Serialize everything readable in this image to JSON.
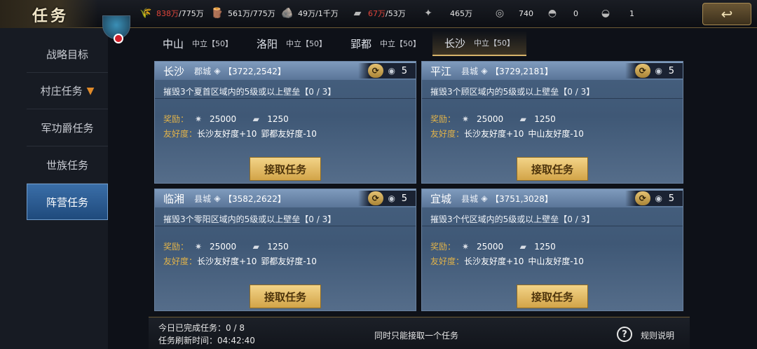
{
  "header": {
    "title": "任务",
    "back_glyph": "↩",
    "resources": [
      {
        "icon": "grain-icon",
        "glyph": "🌾",
        "value": "838万",
        "cap": "/775万",
        "over_cap": true
      },
      {
        "icon": "wood-icon",
        "glyph": "🪵",
        "value": "561万",
        "cap": "/775万",
        "over_cap": false
      },
      {
        "icon": "stone-icon",
        "glyph": "🪨",
        "value": "49万",
        "cap": "/1千万",
        "over_cap": false
      },
      {
        "icon": "iron-icon",
        "glyph": "▰",
        "value": "67万",
        "cap": "/53万",
        "over_cap": true
      },
      {
        "icon": "decree-icon",
        "glyph": "✦",
        "value": "465万",
        "cap": "",
        "over_cap": false
      },
      {
        "icon": "copper-coin-icon",
        "glyph": "◎",
        "value": "740",
        "cap": "",
        "over_cap": false
      },
      {
        "icon": "gold-ingot-icon",
        "glyph": "◓",
        "value": "0",
        "cap": "",
        "over_cap": false
      },
      {
        "icon": "silver-ingot-icon",
        "glyph": "◒",
        "value": "1",
        "cap": "",
        "over_cap": false
      }
    ]
  },
  "sidebar": {
    "items": [
      {
        "label": "战略目标",
        "active": false,
        "arrow": ""
      },
      {
        "label": "村庄任务",
        "active": false,
        "arrow": "▼"
      },
      {
        "label": "军功爵任务",
        "active": false,
        "arrow": ""
      },
      {
        "label": "世族任务",
        "active": false,
        "arrow": ""
      },
      {
        "label": "阵营任务",
        "active": true,
        "arrow": ""
      }
    ]
  },
  "tabs": [
    {
      "city": "中山",
      "status": "中立【50】",
      "active": false
    },
    {
      "city": "洛阳",
      "status": "中立【50】",
      "active": false
    },
    {
      "city": "郢都",
      "status": "中立【50】",
      "active": false
    },
    {
      "city": "长沙",
      "status": "中立【50】",
      "active": true
    }
  ],
  "cards": [
    {
      "city": "长沙",
      "type": "郡城",
      "coord": "【3722,2542】",
      "badge": "5",
      "desc": "摧毁3个夏首区域内的5级或以上壁垒【0 / 3】",
      "reward_label": "奖励：",
      "reward1": "25000",
      "reward2": "1250",
      "friend_label": "友好度：",
      "friend1": "长沙友好度+10",
      "friend2": "郢都友好度-10",
      "button": "接取任务"
    },
    {
      "city": "平江",
      "type": "县城",
      "coord": "【3729,2181】",
      "badge": "5",
      "desc": "摧毁3个顾区域内的5级或以上壁垒【0 / 3】",
      "reward_label": "奖励：",
      "reward1": "25000",
      "reward2": "1250",
      "friend_label": "友好度：",
      "friend1": "长沙友好度+10",
      "friend2": "中山友好度-10",
      "button": "接取任务"
    },
    {
      "city": "临湘",
      "type": "县城",
      "coord": "【3582,2622】",
      "badge": "5",
      "desc": "摧毁3个零阳区域内的5级或以上壁垒【0 / 3】",
      "reward_label": "奖励：",
      "reward1": "25000",
      "reward2": "1250",
      "friend_label": "友好度：",
      "friend1": "长沙友好度+10",
      "friend2": "郢都友好度-10",
      "button": "接取任务"
    },
    {
      "city": "宜城",
      "type": "县城",
      "coord": "【3751,3028】",
      "badge": "5",
      "desc": "摧毁3个代区域内的5级或以上壁垒【0 / 3】",
      "reward_label": "奖励：",
      "reward1": "25000",
      "reward2": "1250",
      "friend_label": "友好度：",
      "friend1": "长沙友好度+10",
      "friend2": "中山友好度-10",
      "button": "接取任务"
    }
  ],
  "footer": {
    "daily_done_label": "今日已完成任务：",
    "daily_done_value": "0 / 8",
    "refresh_label": "任务刷新时间：",
    "refresh_value": "04:42:40",
    "notice": "同时只能接取一个任务",
    "help_glyph": "?",
    "help_label": "规则说明"
  },
  "colors": {
    "accent_gold": "#d6b36a",
    "over_cap_red": "#e0443a",
    "active_blue": "#2f5f96"
  }
}
